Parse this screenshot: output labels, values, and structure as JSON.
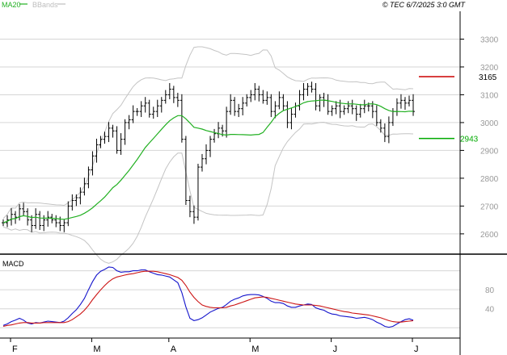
{
  "chart_data": [
    {
      "type": "ohlc",
      "legend": [
        {
          "name": "MA20",
          "color": "#22b022"
        },
        {
          "name": "BBands",
          "color": "#bdbdbd"
        }
      ],
      "timestamp": "© TEC 6/7/2025 3:0 GMT",
      "ylim": [
        2530,
        3400
      ],
      "yticks": [
        {
          "value": 2600,
          "label": "2600"
        },
        {
          "value": 2700,
          "label": "2700"
        },
        {
          "value": 2800,
          "label": "2800"
        },
        {
          "value": 2900,
          "label": "2900"
        },
        {
          "value": 3000,
          "label": "3000"
        },
        {
          "value": 3100,
          "label": "3100"
        },
        {
          "value": 3200,
          "label": "3200"
        },
        {
          "value": 3300,
          "label": "3300"
        }
      ],
      "levels": [
        {
          "value": 3165,
          "label": "3165",
          "color": "#cc0000"
        },
        {
          "value": 2943,
          "label": "2943",
          "color": "#00aa00"
        }
      ],
      "price": [
        2640,
        2650,
        2670,
        2660,
        2690,
        2680,
        2650,
        2630,
        2670,
        2630,
        2650,
        2660,
        2650,
        2640,
        2630,
        2640,
        2700,
        2720,
        2730,
        2750,
        2780,
        2830,
        2880,
        2920,
        2940,
        2950,
        2980,
        2970,
        2900,
        2940,
        3000,
        3010,
        3040,
        3040,
        3060,
        3070,
        3030,
        3040,
        3060,
        3080,
        3100,
        3120,
        3090,
        3080,
        2940,
        2720,
        2680,
        2660,
        2840,
        2870,
        2900,
        2940,
        2960,
        2980,
        2970,
        3040,
        3080,
        3040,
        3050,
        3070,
        3090,
        3100,
        3120,
        3100,
        3080,
        3090,
        3040,
        3060,
        3090,
        3060,
        3000,
        3030,
        3060,
        3100,
        3120,
        3130,
        3120,
        3060,
        3090,
        3080,
        3040,
        3050,
        3060,
        3040,
        3050,
        3060,
        3050,
        3030,
        3050,
        3060,
        3060,
        3040,
        3000,
        2980,
        2950,
        3000,
        3040,
        3070,
        3080,
        3070,
        3080,
        3040
      ]
    },
    {
      "type": "line",
      "title": "MACD",
      "series": [
        {
          "name": "MACD",
          "color": "#1414cc",
          "values": [
            5,
            8,
            13,
            16,
            20,
            16,
            10,
            8,
            11,
            10,
            12,
            14,
            13,
            12,
            11,
            14,
            21,
            30,
            38,
            49,
            62,
            80,
            97,
            111,
            119,
            123,
            128,
            127,
            120,
            117,
            118,
            118,
            120,
            120,
            122,
            122,
            118,
            115,
            112,
            111,
            109,
            107,
            101,
            95,
            74,
            44,
            20,
            15,
            17,
            21,
            27,
            33,
            37,
            41,
            43,
            49,
            56,
            60,
            63,
            67,
            69,
            70,
            70,
            69,
            66,
            62,
            56,
            53,
            53,
            51,
            46,
            43,
            43,
            46,
            48,
            50,
            49,
            42,
            39,
            37,
            32,
            29,
            28,
            25,
            24,
            23,
            22,
            20,
            21,
            22,
            20,
            17,
            12,
            8,
            3,
            1,
            3,
            8,
            13,
            17,
            19,
            16
          ]
        },
        {
          "name": "Signal",
          "color": "#cc1414",
          "values": [
            3,
            5,
            6,
            8,
            10,
            11,
            11,
            10,
            10,
            10,
            11,
            11,
            11,
            11,
            11,
            11,
            13,
            17,
            23,
            29,
            37,
            47,
            59,
            70,
            80,
            89,
            97,
            103,
            107,
            109,
            111,
            113,
            114,
            116,
            118,
            119,
            119,
            119,
            118,
            116,
            114,
            112,
            109,
            106,
            100,
            89,
            75,
            64,
            55,
            48,
            45,
            43,
            42,
            42,
            42,
            43,
            46,
            48,
            51,
            54,
            57,
            60,
            63,
            64,
            65,
            64,
            62,
            60,
            58,
            56,
            54,
            52,
            50,
            49,
            48,
            48,
            48,
            47,
            46,
            44,
            42,
            40,
            38,
            36,
            34,
            33,
            31,
            30,
            29,
            28,
            27,
            25,
            23,
            21,
            18,
            15,
            13,
            12,
            12,
            13,
            14,
            15
          ]
        },
        {
          "name": "Band",
          "color": "#000000",
          "values": []
        }
      ],
      "ylim": [
        -20,
        150
      ],
      "yticks": [
        {
          "value": 40,
          "label": "40"
        },
        {
          "value": 80,
          "label": "80"
        }
      ]
    }
  ],
  "xaxis": {
    "ticks": [
      {
        "index": 1,
        "label": "F"
      },
      {
        "index": 21,
        "label": "M"
      },
      {
        "index": 40,
        "label": "A"
      },
      {
        "index": 60,
        "label": "M"
      },
      {
        "index": 80,
        "label": "J"
      },
      {
        "index": 100,
        "label": "J"
      }
    ]
  }
}
